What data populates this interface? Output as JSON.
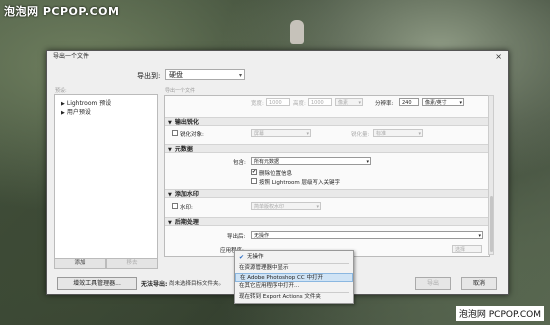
{
  "watermarks": {
    "top": "泡泡网 PCPOP.COM",
    "bottom": "泡泡网 PCPOP.COM"
  },
  "dialog": {
    "title": "导出一个文件",
    "close_glyph": "×",
    "export_to_label": "导出到:",
    "export_to_value": "硬盘",
    "preset_header": "预设:",
    "presets": [
      {
        "label": "Lightroom 预设",
        "icon": "▶"
      },
      {
        "label": "用户预设",
        "icon": "▶"
      }
    ],
    "add_button": "添加",
    "remove_button": "移去",
    "settings_caption": "导出一个文件",
    "size_row": {
      "width_label": "宽度:",
      "width_value": "1000",
      "height_label": "高度:",
      "height_value": "1000",
      "unit": "像素",
      "res_label": "分辨率:",
      "res_value": "240",
      "res_unit": "像素/英寸"
    },
    "sections": {
      "sharpen": {
        "title": "输出锐化",
        "checkbox_label": "锐化对象:",
        "target": "屏幕",
        "amount_label": "锐化量:",
        "amount": "标准"
      },
      "metadata": {
        "title": "元数据",
        "include_label": "包含:",
        "include_value": "所有元数据",
        "opt1": "删除位置信息",
        "opt2": "按照 Lightroom 层级写入关键字"
      },
      "watermark": {
        "title": "添加水印",
        "checkbox_label": "水印:",
        "value": "简单版权水印"
      },
      "post": {
        "title": "后期处理",
        "after_label": "导出后:",
        "after_value": "无操作",
        "app_label": "应用程序:",
        "choose_button": "选择"
      }
    },
    "plugin_button": "增效工具管理器...",
    "no_export_title": "无法导出:",
    "no_export_msg": "尚未选择目标文件夹。",
    "export_button": "导出",
    "cancel_button": "取消"
  },
  "menu": {
    "items": [
      {
        "label": "无操作",
        "checked": true
      },
      {
        "label": "在资源管理器中显示",
        "checked": false
      },
      {
        "label": "在 Adobe Photoshop CC 中打开",
        "checked": false,
        "highlight": true
      },
      {
        "label": "在其它应用程序中打开...",
        "checked": false
      },
      {
        "label": "现在转到 Export Actions 文件夹",
        "checked": false
      }
    ],
    "check_glyph": "✔"
  }
}
